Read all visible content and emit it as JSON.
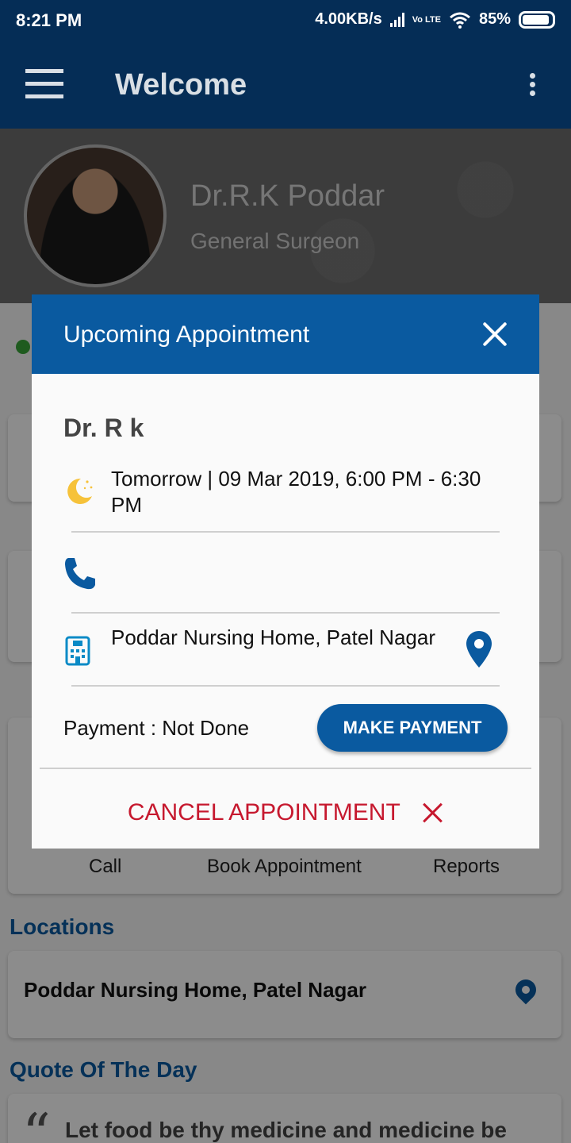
{
  "status_bar": {
    "time": "8:21 PM",
    "network_speed": "4.00KB/s",
    "network_type": "Vo LTE",
    "battery": "85%"
  },
  "app_bar": {
    "title": "Welcome"
  },
  "profile": {
    "name": "Dr.R.K Poddar",
    "specialty": "General Surgeon"
  },
  "background": {
    "quick_actions": [
      "Call",
      "Book Appointment",
      "Reports"
    ],
    "locations_heading": "Locations",
    "location_name": "Poddar Nursing Home, Patel Nagar",
    "quote_heading": "Quote Of The Day",
    "quote_text": "Let food be thy medicine and medicine be"
  },
  "dialog": {
    "title": "Upcoming Appointment",
    "doctor": "Dr. R k",
    "datetime": "Tomorrow | 09 Mar 2019, 6:00 PM - 6:30 PM",
    "phone": "",
    "clinic": "Poddar Nursing Home, Patel Nagar",
    "payment_status": "Payment : Not Done",
    "make_payment_label": "MAKE PAYMENT",
    "cancel_label": "CANCEL APPOINTMENT"
  },
  "colors": {
    "primary": "#0a5aa0",
    "app_bar": "#052d56",
    "cancel": "#c6182e"
  }
}
